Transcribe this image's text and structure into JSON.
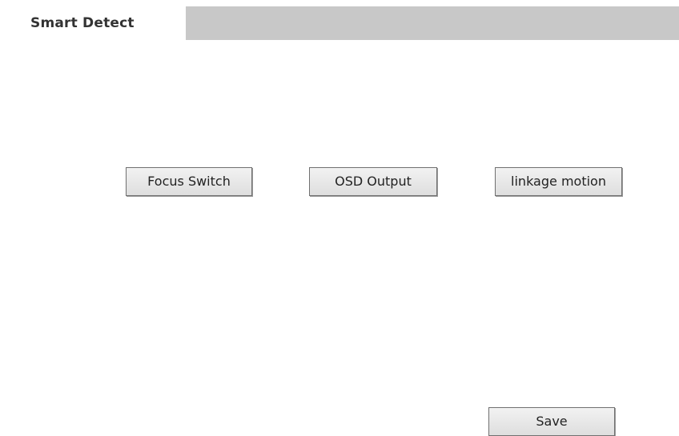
{
  "tabs": {
    "active_label": "Smart Detect"
  },
  "actions": {
    "focus_switch_label": "Focus Switch",
    "osd_output_label": "OSD Output",
    "linkage_motion_label": "linkage motion"
  },
  "footer": {
    "save_label": "Save"
  },
  "colors": {
    "tab_strip": "#c8c8c8",
    "tab_active": "#ffffff",
    "button_border": "#707070",
    "text": "#222222"
  }
}
